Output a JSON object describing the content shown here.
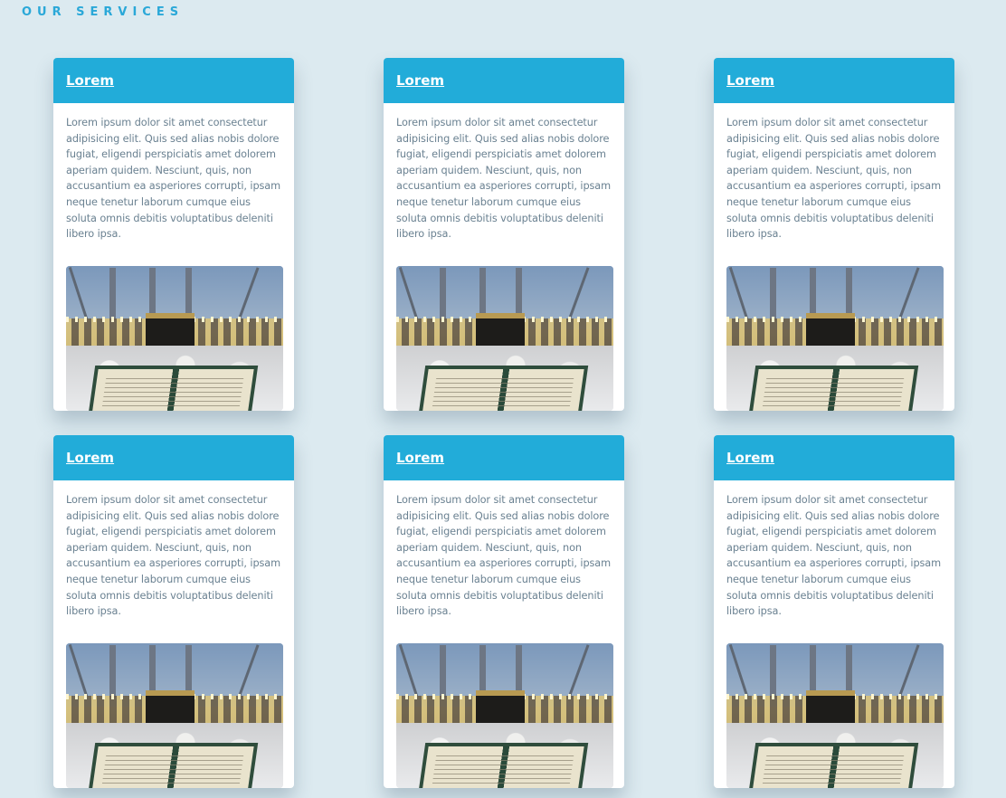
{
  "section": {
    "title": "OUR SERVICES"
  },
  "cards": [
    {
      "title": "Lorem",
      "text": "Lorem ipsum dolor sit amet consectetur adipisicing elit. Quis sed alias nobis dolore fugiat, eligendi perspiciatis amet dolorem aperiam quidem. Nesciunt, quis, non accusantium ea asperiores corrupti, ipsam neque tenetur laborum cumque eius soluta omnis debitis voluptatibus deleniti libero ipsa.",
      "image": "kaaba-quran-photo"
    },
    {
      "title": "Lorem",
      "text": "Lorem ipsum dolor sit amet consectetur adipisicing elit. Quis sed alias nobis dolore fugiat, eligendi perspiciatis amet dolorem aperiam quidem. Nesciunt, quis, non accusantium ea asperiores corrupti, ipsam neque tenetur laborum cumque eius soluta omnis debitis voluptatibus deleniti libero ipsa.",
      "image": "kaaba-quran-photo"
    },
    {
      "title": "Lorem",
      "text": "Lorem ipsum dolor sit amet consectetur adipisicing elit. Quis sed alias nobis dolore fugiat, eligendi perspiciatis amet dolorem aperiam quidem. Nesciunt, quis, non accusantium ea asperiores corrupti, ipsam neque tenetur laborum cumque eius soluta omnis debitis voluptatibus deleniti libero ipsa.",
      "image": "kaaba-quran-photo"
    },
    {
      "title": "Lorem",
      "text": "Lorem ipsum dolor sit amet consectetur adipisicing elit. Quis sed alias nobis dolore fugiat, eligendi perspiciatis amet dolorem aperiam quidem. Nesciunt, quis, non accusantium ea asperiores corrupti, ipsam neque tenetur laborum cumque eius soluta omnis debitis voluptatibus deleniti libero ipsa.",
      "image": "kaaba-quran-photo"
    },
    {
      "title": "Lorem",
      "text": "Lorem ipsum dolor sit amet consectetur adipisicing elit. Quis sed alias nobis dolore fugiat, eligendi perspiciatis amet dolorem aperiam quidem. Nesciunt, quis, non accusantium ea asperiores corrupti, ipsam neque tenetur laborum cumque eius soluta omnis debitis voluptatibus deleniti libero ipsa.",
      "image": "kaaba-quran-photo"
    },
    {
      "title": "Lorem",
      "text": "Lorem ipsum dolor sit amet consectetur adipisicing elit. Quis sed alias nobis dolore fugiat, eligendi perspiciatis amet dolorem aperiam quidem. Nesciunt, quis, non accusantium ea asperiores corrupti, ipsam neque tenetur laborum cumque eius soluta omnis debitis voluptatibus deleniti libero ipsa.",
      "image": "kaaba-quran-photo"
    }
  ],
  "colors": {
    "accent": "#22acd9",
    "background": "#dceaf0",
    "body_text": "#6a8191",
    "heading": "#2aa8d8"
  }
}
